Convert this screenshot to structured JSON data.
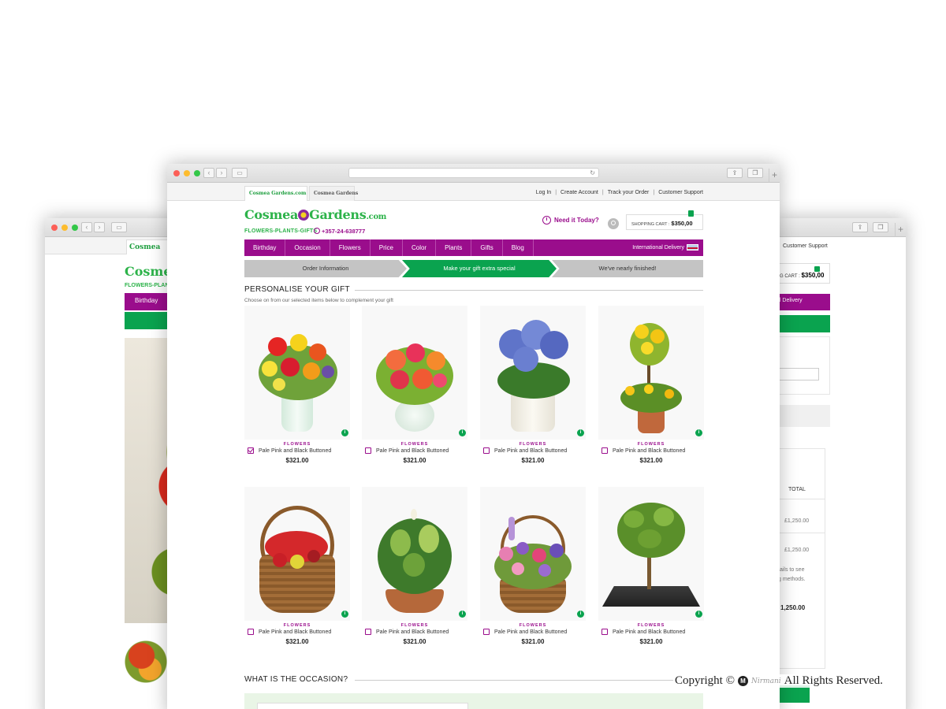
{
  "site": {
    "logo": "Cosmea",
    "logo2": "Gardens",
    "logo_com": ".com",
    "tagline": "FLOWERS-PLANTS-GIFTS",
    "phone": "+357-24-638777",
    "tab1": "Cosmea Gardens.com",
    "tab2": "Cosmea Gardens"
  },
  "toplinks": [
    "Log In",
    "Create Account",
    "Track your Order",
    "Customer Support"
  ],
  "need_it_today": "Need it Today?",
  "cart": {
    "label": "SHOPPING CART :",
    "amount": "$350,00"
  },
  "nav": [
    "Birthday",
    "Occasion",
    "Flowers",
    "Price",
    "Color",
    "Plants",
    "Gifts",
    "Blog"
  ],
  "intl_delivery": "International Delivery",
  "steps": [
    "Order Information",
    "Make your gift extra special",
    "We've nearly finished!"
  ],
  "personalise": {
    "title": "PERSONALISE YOUR GIFT",
    "subtitle": "Choose on from our selected items below to complement your gift"
  },
  "products": [
    {
      "category": "FLOWERS",
      "name": "Pale Pink and Black Buttoned",
      "price": "$321.00",
      "checked": true
    },
    {
      "category": "FLOWERS",
      "name": "Pale Pink and Black Buttoned",
      "price": "$321.00",
      "checked": false
    },
    {
      "category": "FLOWERS",
      "name": "Pale Pink and Black Buttoned",
      "price": "$321.00",
      "checked": false
    },
    {
      "category": "FLOWERS",
      "name": "Pale Pink and Black Buttoned",
      "price": "$321.00",
      "checked": false
    },
    {
      "category": "FLOWERS",
      "name": "Pale Pink and Black Buttoned",
      "price": "$321.00",
      "checked": false
    },
    {
      "category": "FLOWERS",
      "name": "Pale Pink and Black Buttoned",
      "price": "$321.00",
      "checked": false
    },
    {
      "category": "FLOWERS",
      "name": "Pale Pink and Black Buttoned",
      "price": "$321.00",
      "checked": false
    },
    {
      "category": "FLOWERS",
      "name": "Pale Pink and Black Buttoned",
      "price": "$321.00",
      "checked": false
    }
  ],
  "occasion_title": "WHAT IS THE OCCASION?",
  "left_window": {
    "logo": "Cosmea",
    "tagline": "FLOWERS-PLANT",
    "nav_item": "Birthday",
    "tab": "Cosmea"
  },
  "right_window": {
    "support": "Customer Support",
    "cart_label": "G CART :",
    "cart_amount": "$350,00",
    "intl": "al Delivery",
    "total_label": "TOTAL",
    "v1": "£1,250.00",
    "v2": "£1,250.00",
    "note1": "tails to see",
    "note2": "g methods.",
    "big_total": "1,250.00"
  },
  "copyright": {
    "prefix": "Copyright ©",
    "suffix": "All Rights Reserved.",
    "mark": "M",
    "signature": "Nirmani"
  },
  "colors": {
    "purple": "#9a0d8c",
    "green": "#0aa34f",
    "logo_green": "#2db34a"
  }
}
